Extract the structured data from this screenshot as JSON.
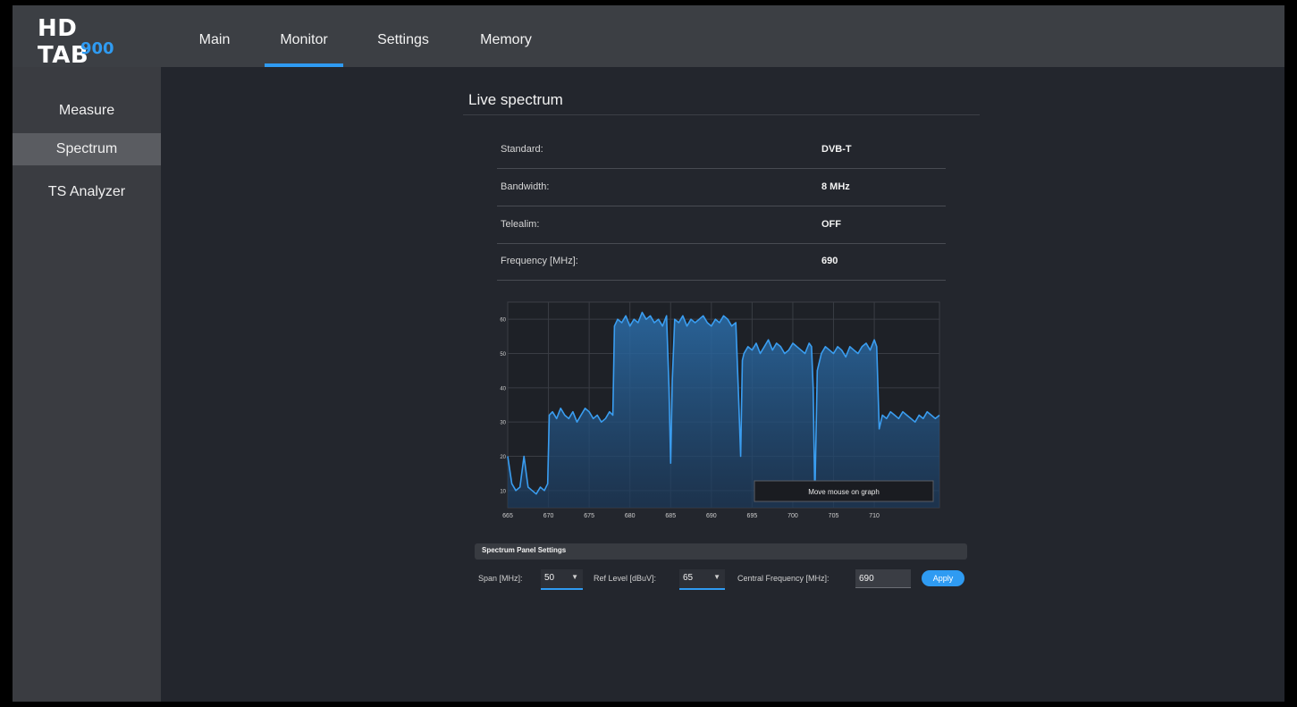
{
  "app": {
    "logo_main": "HD TAB",
    "logo_sub": "900"
  },
  "nav": {
    "tabs": [
      {
        "label": "Main"
      },
      {
        "label": "Monitor",
        "active": true
      },
      {
        "label": "Settings"
      },
      {
        "label": "Memory"
      }
    ]
  },
  "sidebar": {
    "items": [
      {
        "label": "Measure"
      },
      {
        "label": "Spectrum",
        "active": true
      },
      {
        "label": "TS Analyzer"
      }
    ]
  },
  "main": {
    "title": "Live spectrum",
    "info": [
      {
        "label": "Standard:",
        "value": "DVB-T"
      },
      {
        "label": "Bandwidth:",
        "value": "8 MHz"
      },
      {
        "label": "Telealim:",
        "value": "OFF"
      },
      {
        "label": "Frequency [MHz]:",
        "value": "690"
      }
    ],
    "tooltip": "Move mouse on graph"
  },
  "settings": {
    "header": "Spectrum Panel Settings",
    "span_label": "Span [MHz]:",
    "span_value": "50",
    "ref_label": "Ref Level [dBuV]:",
    "ref_value": "65",
    "freq_label": "Central Frequency [MHz]:",
    "freq_value": "690",
    "apply_label": "Apply"
  },
  "colors": {
    "accent": "#2f9bf2",
    "background": "#23262d",
    "topbar": "#3c3f44",
    "sidebar": "#3a3c41",
    "trace": "#3a9df0"
  },
  "chart_data": {
    "type": "area",
    "xlabel": "",
    "ylabel": "",
    "xlim": [
      665,
      718
    ],
    "ylim": [
      5,
      65
    ],
    "x_ticks": [
      665,
      670,
      675,
      680,
      685,
      690,
      695,
      700,
      705,
      710
    ],
    "x_tick_labels": [
      "665",
      "670",
      "675",
      "680",
      "685",
      "690",
      "695",
      "700",
      "705",
      "710"
    ],
    "y_ticks": [
      10,
      20,
      30,
      40,
      50,
      60
    ],
    "y_tick_labels": [
      "10",
      "20",
      "30",
      "40",
      "50",
      "60"
    ],
    "grid": true,
    "series": [
      {
        "x": [
          665,
          665.5,
          666,
          666.5,
          667,
          667.5,
          668,
          668.5,
          669,
          669.5,
          669.9,
          670.1,
          670.5,
          671,
          671.5,
          672,
          672.5,
          673,
          673.5,
          674,
          674.5,
          675,
          675.5,
          676,
          676.5,
          677,
          677.5,
          677.9,
          678.1,
          678.5,
          679,
          679.5,
          680,
          680.5,
          681,
          681.5,
          682,
          682.5,
          683,
          683.5,
          684,
          684.5,
          684.8,
          685.0,
          685.2,
          685.5,
          686,
          686.5,
          687,
          687.5,
          688,
          688.5,
          689,
          689.5,
          690,
          690.5,
          691,
          691.5,
          692,
          692.5,
          693,
          693.3,
          693.6,
          693.8,
          694,
          694.5,
          695,
          695.5,
          696,
          696.5,
          697,
          697.5,
          698,
          698.5,
          699,
          699.5,
          700,
          700.5,
          701,
          701.5,
          702,
          702.3,
          702.5,
          702.7,
          703,
          703.5,
          704,
          704.5,
          705,
          705.5,
          706,
          706.5,
          707,
          707.5,
          708,
          708.5,
          709,
          709.5,
          710,
          710.3,
          710.6,
          711,
          711.5,
          712,
          712.5,
          713,
          713.5,
          714,
          714.5,
          715,
          715.5,
          716,
          716.5,
          717,
          717.5,
          718
        ],
        "y": [
          20,
          12,
          10,
          11,
          20,
          11,
          10,
          9,
          11,
          10,
          12,
          32,
          33,
          31,
          34,
          32,
          31,
          33,
          30,
          32,
          34,
          33,
          31,
          32,
          30,
          31,
          33,
          32,
          58,
          60,
          59,
          61,
          58,
          60,
          59,
          62,
          60,
          61,
          59,
          60,
          58,
          61,
          40,
          18,
          42,
          60,
          59,
          61,
          58,
          60,
          59,
          60,
          61,
          59,
          58,
          60,
          59,
          61,
          60,
          58,
          59,
          40,
          20,
          48,
          50,
          52,
          51,
          53,
          50,
          52,
          54,
          51,
          53,
          52,
          50,
          51,
          53,
          52,
          51,
          50,
          53,
          52,
          40,
          8,
          45,
          50,
          52,
          51,
          50,
          52,
          51,
          49,
          52,
          51,
          50,
          52,
          53,
          51,
          54,
          52,
          28,
          32,
          31,
          33,
          32,
          31,
          33,
          32,
          31,
          30,
          32,
          31,
          33,
          32,
          31,
          32
        ]
      }
    ]
  }
}
